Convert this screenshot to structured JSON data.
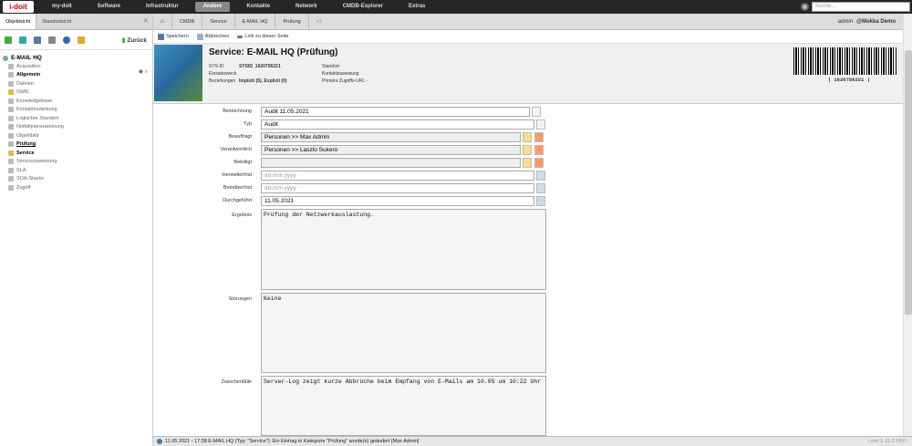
{
  "topnav": {
    "logo": "i-doit",
    "items": [
      "my-doit",
      "Software",
      "Infrastruktur",
      "Andere",
      "Kontakte",
      "Network",
      "CMDB-Explorer",
      "Extras"
    ],
    "active": "Andere",
    "search_placeholder": "Suche..."
  },
  "sidebar": {
    "tabs": [
      "Objektsicht",
      "Standortsicht"
    ],
    "back_label": "Zurück",
    "root": "E-MAIL HQ",
    "items": [
      {
        "label": "Acquisition",
        "style": "normal"
      },
      {
        "label": "Allgemein",
        "style": "bold"
      },
      {
        "label": "Dateien",
        "style": "normal"
      },
      {
        "label": "ISMS",
        "style": "folder"
      },
      {
        "label": "Knowledgebase",
        "style": "normal"
      },
      {
        "label": "Kontaktzuweisung",
        "style": "normal"
      },
      {
        "label": "Logischer Standort",
        "style": "normal"
      },
      {
        "label": "Notfallplanzuweisung",
        "style": "normal"
      },
      {
        "label": "Objektbild",
        "style": "normal"
      },
      {
        "label": "Prüfung",
        "style": "under"
      },
      {
        "label": "Service",
        "style": "folder-bold"
      },
      {
        "label": "Servicezuweisung",
        "style": "normal"
      },
      {
        "label": "SLA",
        "style": "normal"
      },
      {
        "label": "SOA-Stacks",
        "style": "normal"
      },
      {
        "label": "Zugriff",
        "style": "normal"
      }
    ]
  },
  "breadcrumb": [
    "CMDB",
    "Service",
    "E-MAIL HQ",
    "Prüfung",
    "#1"
  ],
  "user": {
    "name": "admin",
    "tenant": "@Mokka Demo"
  },
  "actions": {
    "save": "Speichern",
    "cancel": "Abbrechen",
    "link": "Link zu dieser Seite"
  },
  "header": {
    "title": "Service: E-MAIL HQ (Prüfung)",
    "sysid_label": "SYS-ID",
    "sysid": "SYSID_1620756221",
    "einsatzzweck_label": "Einsatzzweck",
    "beziehungen_label": "Beziehungen",
    "beziehungen": "Implizit (5), Explizit (0)",
    "standort_label": "Standort",
    "kontakt_label": "Kontaktzuweisung",
    "url_label": "Primäre Zugriffs-URL",
    "url_value": "-",
    "barcode": "| 1620756221 |"
  },
  "form": {
    "bezeichnung": {
      "label": "Bezeichnung",
      "value": "Audit 11.05.2021"
    },
    "typ": {
      "label": "Typ",
      "value": "Audit"
    },
    "beauftragt": {
      "label": "Beauftragt",
      "value": "Personen >> Max Admin"
    },
    "verantwortlich": {
      "label": "Verantwortlich",
      "value": "Personen >> Laszlo Sukero"
    },
    "beteiligt": {
      "label": "Beteiligt",
      "value": ""
    },
    "herstellerfrist": {
      "label": "Herstellerfrist",
      "placeholder": "dd.mm.yyyy"
    },
    "betreiberfrist": {
      "label": "Betreiberfrist",
      "placeholder": "dd.mm.yyyy"
    },
    "durchgefuehrt": {
      "label": "Durchgeführt",
      "value": "11.05.2021"
    },
    "ergebnis": {
      "label": "Ergebnis",
      "value": "Prüfung der Netzwerkauslastung."
    },
    "stoerungen": {
      "label": "Störungen",
      "value": "Keine"
    },
    "zwischenfaelle": {
      "label": "Zwischenfälle",
      "value": "Server-Log zeigt kurze Abbrüche beim Empfang von E-Mails am 10.05 um 10:22 Uhr"
    }
  },
  "status": {
    "message": "11.05.2021 - 17:38 E-MAIL HQ (Typ: \"Service\"): Ein Eintrag in Kategorie \"Prüfung\" wurde(n) geändert [Max Admin]",
    "version": "i-doit 1.15.2 PRO"
  }
}
